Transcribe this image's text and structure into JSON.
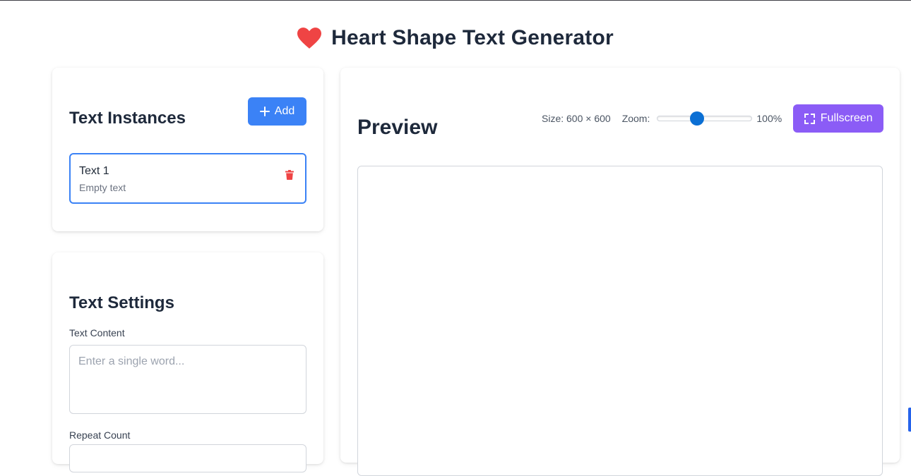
{
  "app": {
    "title": "Heart Shape Text Generator",
    "icon": "heart-icon",
    "heart_color": "#ef4444"
  },
  "instances": {
    "title": "Text Instances",
    "add_label": "Add",
    "add_icon": "plus-icon",
    "add_color": "#3b82f6",
    "items": [
      {
        "name": "Text 1",
        "subtitle": "Empty text",
        "selected": true,
        "delete_icon": "trash-icon",
        "delete_color": "#ef4444"
      }
    ]
  },
  "settings": {
    "title": "Text Settings",
    "text_content_label": "Text Content",
    "text_content_placeholder": "Enter a single word...",
    "text_content_value": "",
    "repeat_count_label": "Repeat Count"
  },
  "preview": {
    "title": "Preview",
    "size_text": "Size: 600 × 600",
    "zoom_label": "Zoom:",
    "zoom_value_text": "100%",
    "zoom_slider_fraction": 0.42,
    "fullscreen_label": "Fullscreen",
    "fullscreen_icon": "expand-icon",
    "fullscreen_color": "#8b5cf6"
  }
}
